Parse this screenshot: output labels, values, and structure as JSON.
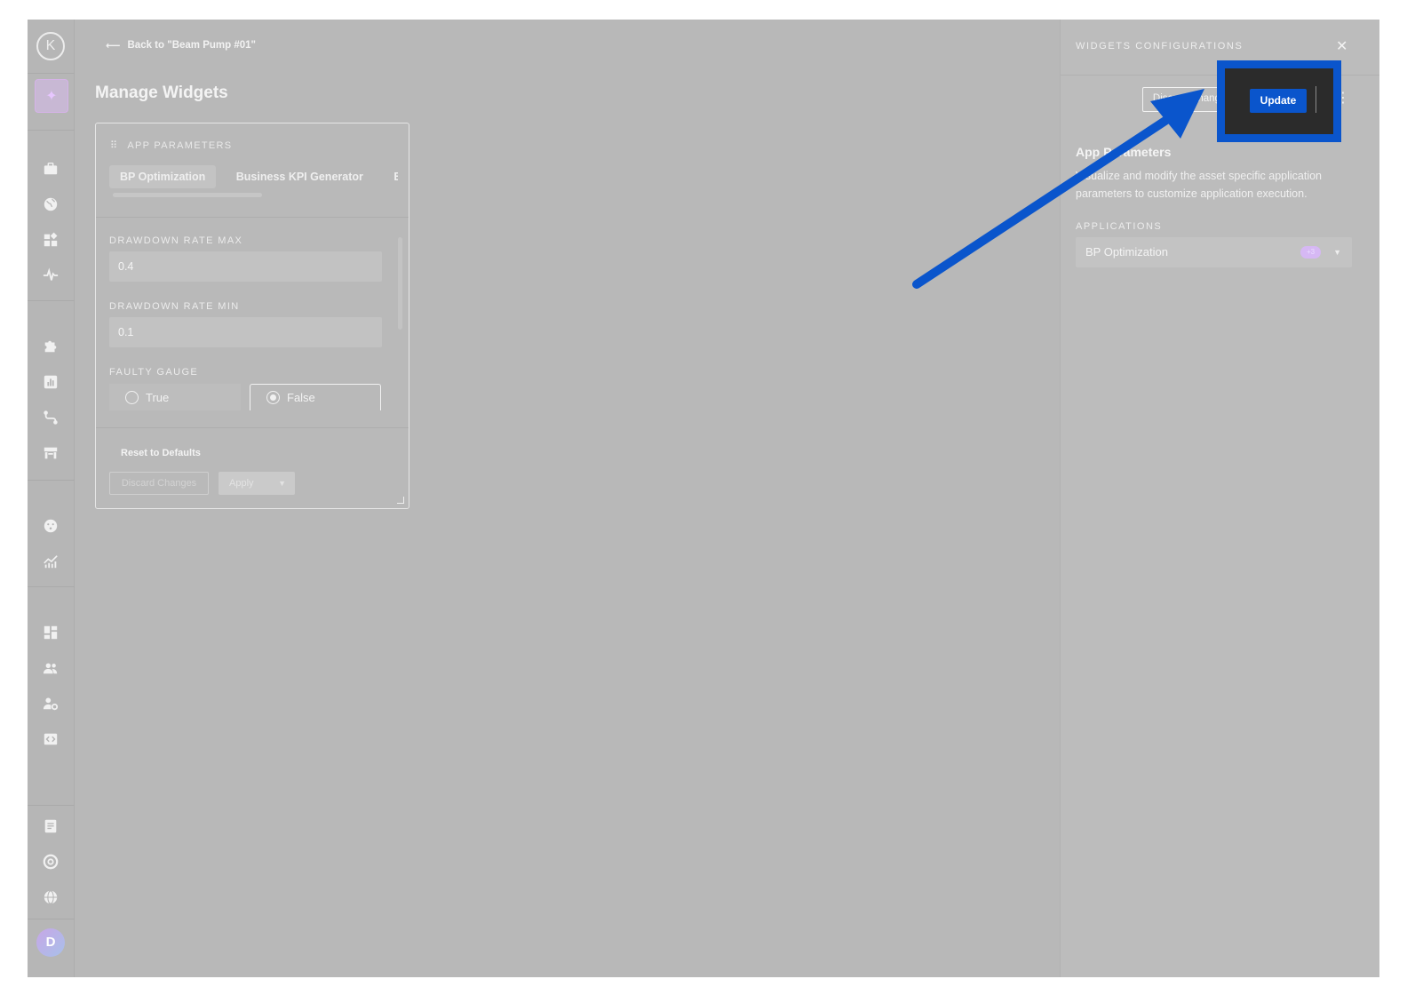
{
  "sidebar": {
    "logo_letter": "K",
    "avatar_initial": "D",
    "icons": [
      "briefcase-icon",
      "globe-icon",
      "widgets-icon",
      "pulse-icon",
      "puzzle-icon",
      "bar-chart-icon",
      "route-icon",
      "inventory-icon",
      "smile-icon",
      "analytics-icon",
      "dashboard-icon",
      "users-icon",
      "user-settings-icon",
      "code-icon",
      "document-icon",
      "support-icon",
      "language-icon"
    ]
  },
  "header": {
    "back_arrow": "⟵",
    "back_label": "Back to \"Beam Pump #01\"",
    "page_title": "Manage Widgets"
  },
  "widget": {
    "drag_handle": "⠿",
    "title": "APP PARAMETERS",
    "tabs": [
      {
        "label": "BP Optimization",
        "active": true
      },
      {
        "label": "Business KPI Generator",
        "active": false
      },
      {
        "label": "E",
        "active": false
      }
    ],
    "fields": [
      {
        "label": "DRAWDOWN RATE MAX",
        "value": "0.4"
      },
      {
        "label": "DRAWDOWN RATE MIN",
        "value": "0.1"
      }
    ],
    "faulty_gauge": {
      "label": "FAULTY GAUGE",
      "options": [
        "True",
        "False"
      ],
      "selected": "False"
    },
    "reset_label": "Reset to Defaults",
    "discard_label": "Discard Changes",
    "apply_label": "Apply",
    "apply_caret": "▼"
  },
  "panel": {
    "title": "WIDGETS CONFIGURATIONS",
    "close": "✕",
    "discard_label": "Discard Changes",
    "update_label": "Update",
    "kebab": "⋮",
    "section_title": "App Parameters",
    "section_description": "Visualize and modify the asset specific application parameters to customize application execution.",
    "applications_label": "APPLICATIONS",
    "applications_value": "BP Optimization",
    "applications_badge": "+3",
    "applications_caret": "▼"
  },
  "colors": {
    "overlay": "#b8b8b8",
    "highlight": "#0a55cc",
    "accent_purple": "#d6b8f4"
  }
}
